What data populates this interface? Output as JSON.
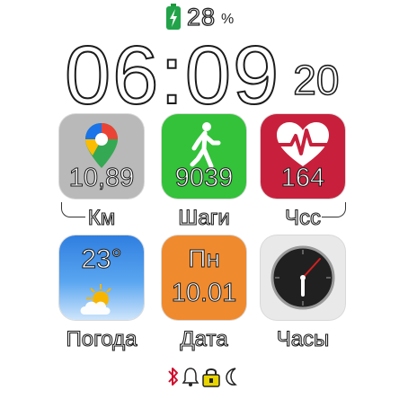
{
  "battery": {
    "value": "28",
    "unit": "%"
  },
  "clock": {
    "time": "06:09",
    "seconds": "20"
  },
  "tiles": [
    {
      "id": "maps",
      "value": "10,89",
      "label": "Км"
    },
    {
      "id": "steps",
      "value": "9039",
      "label": "Шаги"
    },
    {
      "id": "heart",
      "value": "164",
      "label": "Чсс"
    },
    {
      "id": "weather",
      "value": "23°",
      "label": "Погода"
    },
    {
      "id": "date",
      "day": "Пн",
      "value": "10.01",
      "label": "Дата"
    },
    {
      "id": "watch",
      "label": "Часы"
    }
  ],
  "icons": {
    "battery": "lightning-battery-icon",
    "maps": "map-pin-icon",
    "steps": "walking-person-icon",
    "heart": "heart-pulse-icon",
    "weather": "sun-cloud-icon",
    "watch": "analog-clock-icon",
    "status": [
      "bluetooth-icon",
      "bell-icon",
      "lock-icon",
      "moon-icon"
    ]
  },
  "colors": {
    "steps": "#33c23a",
    "heart": "#c8203c",
    "weather": "#2f7ee0",
    "date": "#f08a2e",
    "lock": "#e8d400",
    "bluetooth": "#d01030"
  }
}
